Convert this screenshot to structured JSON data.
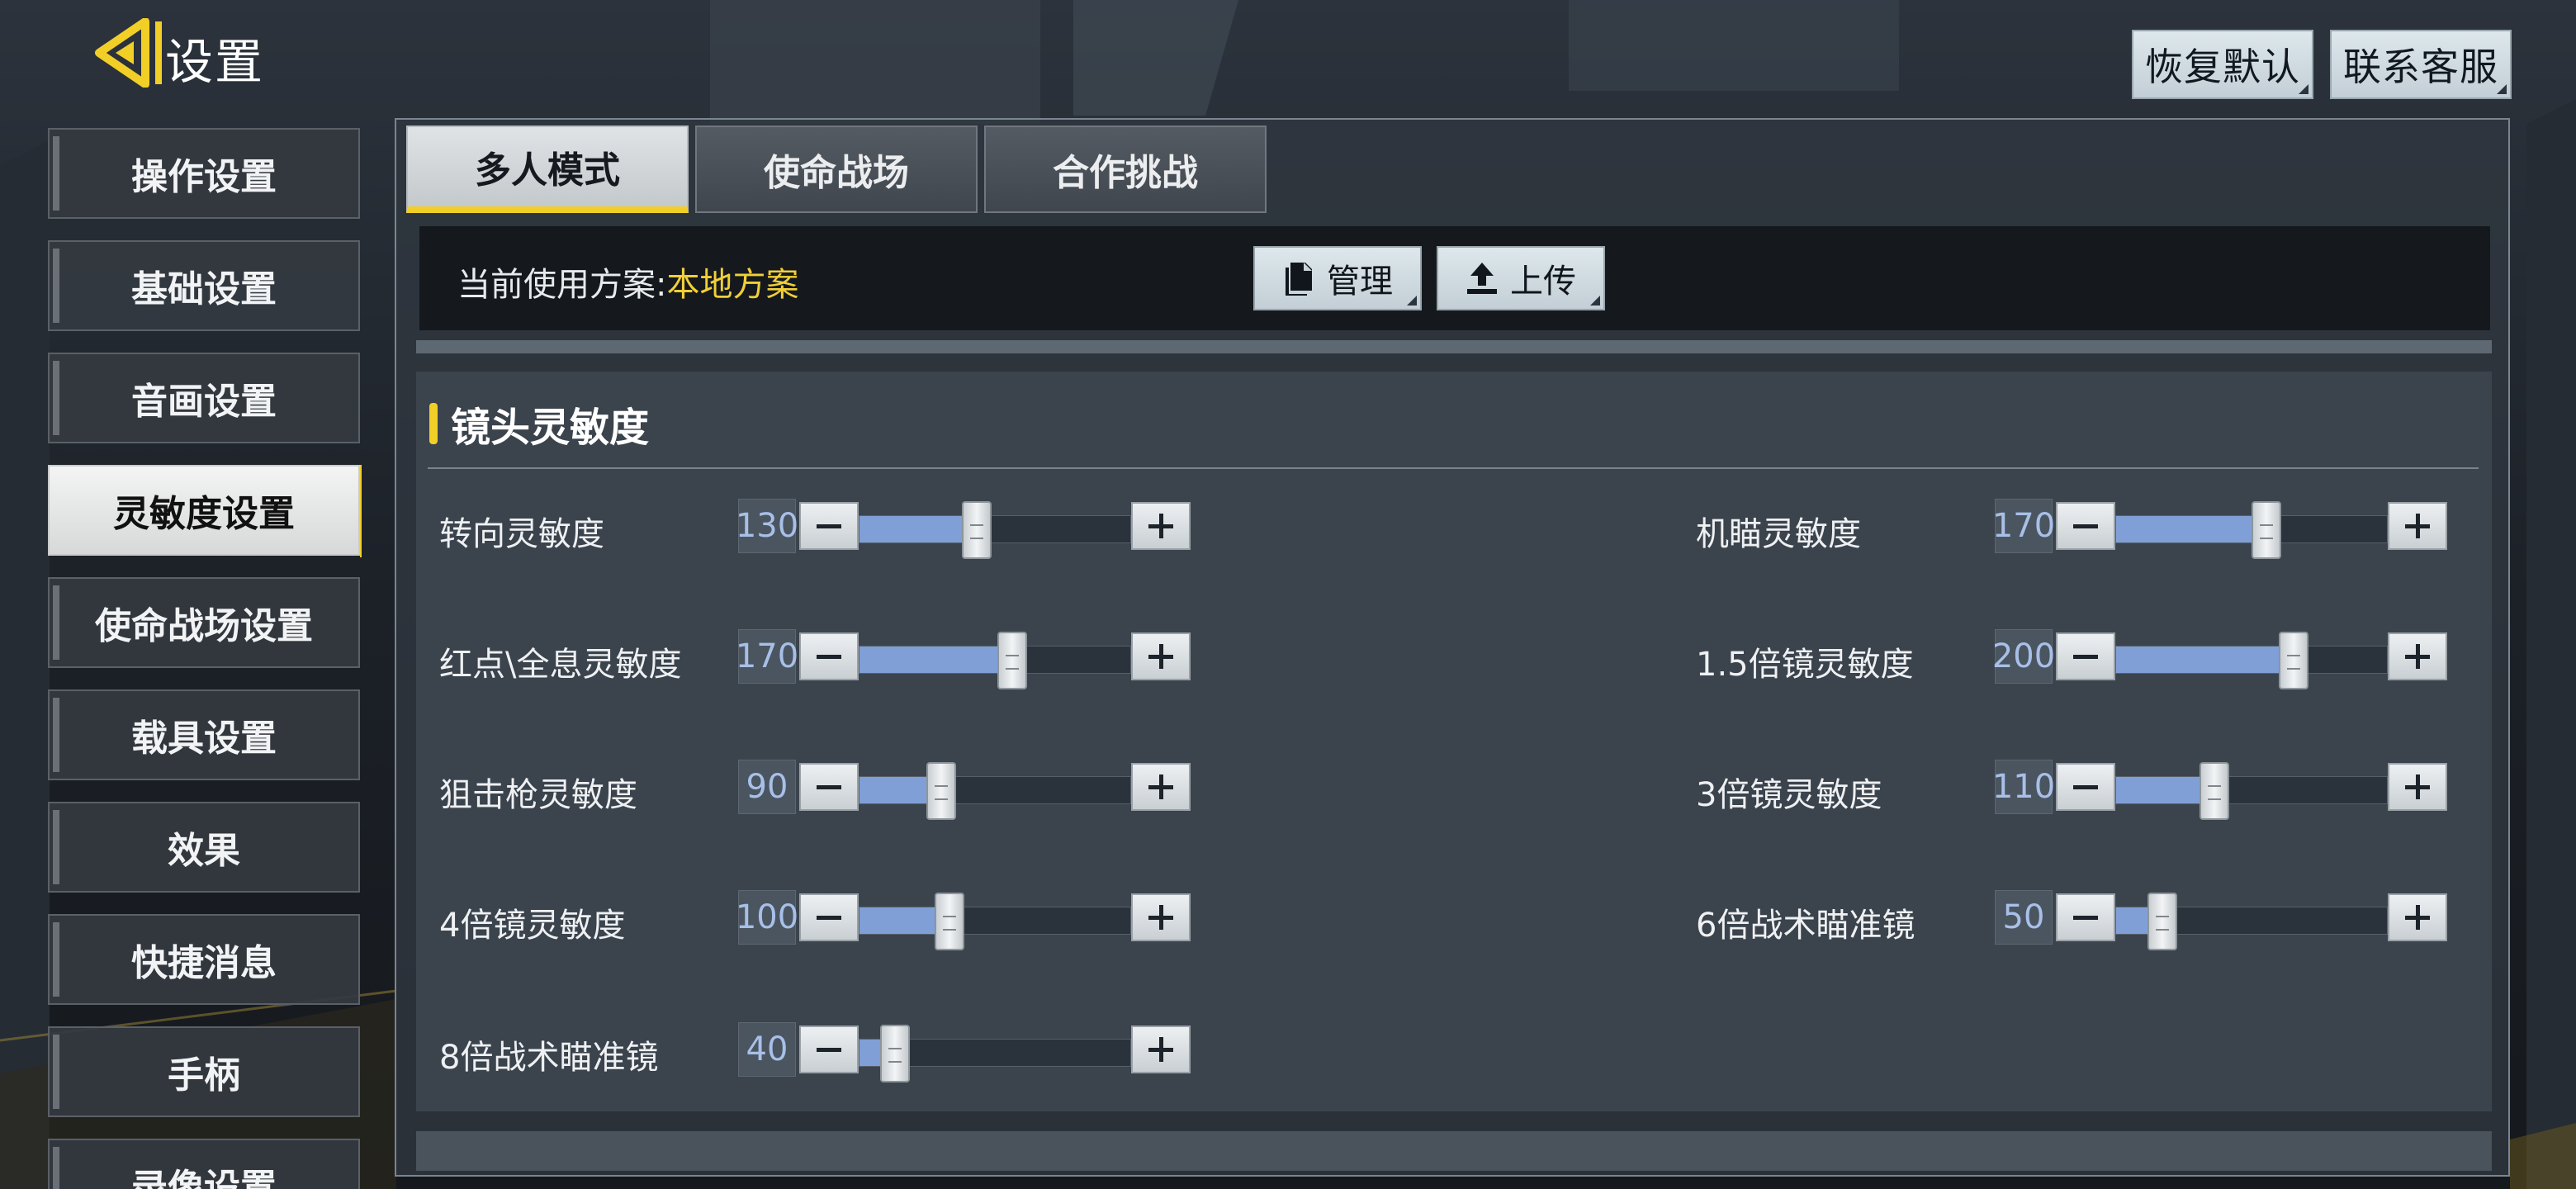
{
  "header": {
    "title": "设置",
    "restore_defaults": "恢复默认",
    "contact_service": "联系客服"
  },
  "menu": {
    "items": [
      {
        "label": "操作设置",
        "active": false
      },
      {
        "label": "基础设置",
        "active": false
      },
      {
        "label": "音画设置",
        "active": false
      },
      {
        "label": "灵敏度设置",
        "active": true
      },
      {
        "label": "使命战场设置",
        "active": false
      },
      {
        "label": "载具设置",
        "active": false
      },
      {
        "label": "效果",
        "active": false
      },
      {
        "label": "快捷消息",
        "active": false
      },
      {
        "label": "手柄",
        "active": false
      },
      {
        "label": "录像设置",
        "active": false
      }
    ]
  },
  "tabs": [
    {
      "label": "多人模式",
      "active": true
    },
    {
      "label": "使命战场",
      "active": false
    },
    {
      "label": "合作挑战",
      "active": false
    }
  ],
  "scheme": {
    "prefix": "当前使用方案:",
    "value": "本地方案",
    "manage_label": "管理",
    "upload_label": "上传"
  },
  "section": {
    "title": "镜头灵敏度"
  },
  "sliders": [
    {
      "label": "转向灵敏度",
      "value": "130",
      "fraction": 0.43
    },
    {
      "label": "机瞄灵敏度",
      "value": "170",
      "fraction": 0.55
    },
    {
      "label": "红点\\全息灵敏度",
      "value": "170",
      "fraction": 0.56
    },
    {
      "label": "1.5倍镜灵敏度",
      "value": "200",
      "fraction": 0.65
    },
    {
      "label": "狙击枪灵敏度",
      "value": "90",
      "fraction": 0.3
    },
    {
      "label": "3倍镜灵敏度",
      "value": "110",
      "fraction": 0.36
    },
    {
      "label": "4倍镜灵敏度",
      "value": "100",
      "fraction": 0.33
    },
    {
      "label": "6倍战术瞄准镜",
      "value": "50",
      "fraction": 0.17
    },
    {
      "label": "8倍战术瞄准镜",
      "value": "40",
      "fraction": 0.13
    }
  ],
  "colors": {
    "accent": "#f1cf27",
    "scheme_value": "#f0cf38",
    "slider_fill": "#7f9fd6",
    "slider_value_text": "#a8c0e8"
  },
  "icons": {
    "back": "back-arrow-icon",
    "manage": "document-icon",
    "upload": "upload-icon",
    "minus": "minus-icon",
    "plus": "plus-icon"
  }
}
